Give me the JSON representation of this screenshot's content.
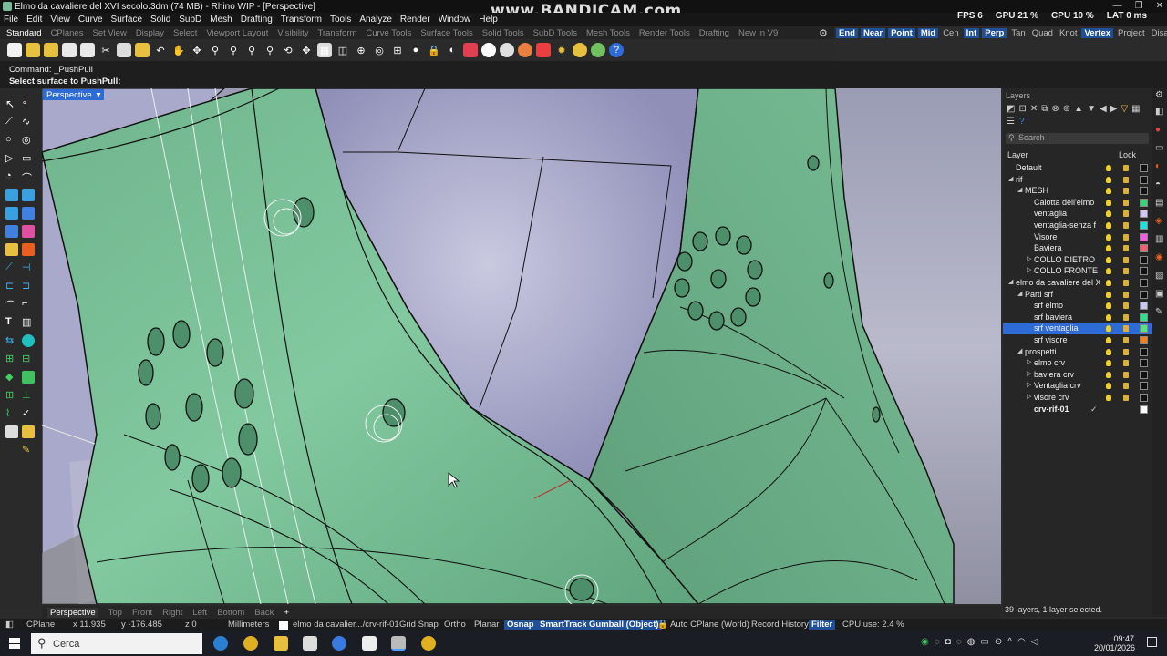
{
  "window": {
    "title": "Elmo da cavaliere del XVI secolo.3dm (74 MB) - Rhino WIP - [Perspective]",
    "watermark": "www.BANDICAM.com",
    "perf": {
      "fps": "FPS   6",
      "gpu": "GPU 21 %",
      "cpu": "CPU 10 %",
      "lat": "LAT 0 ms"
    }
  },
  "menu": [
    "File",
    "Edit",
    "View",
    "Curve",
    "Surface",
    "Solid",
    "SubD",
    "Mesh",
    "Drafting",
    "Transform",
    "Tools",
    "Analyze",
    "Render",
    "Window",
    "Help"
  ],
  "tabs": [
    "Standard",
    "CPlanes",
    "Set View",
    "Display",
    "Select",
    "Viewport Layout",
    "Visibility",
    "Transform",
    "Curve Tools",
    "Surface Tools",
    "Solid Tools",
    "SubD Tools",
    "Mesh Tools",
    "Render Tools",
    "Drafting",
    "New in V9"
  ],
  "osnap": {
    "items": [
      "End",
      "Near",
      "Point",
      "Mid",
      "Cen",
      "Int",
      "Perp",
      "Tan",
      "Quad",
      "Knot",
      "Vertex",
      "Project",
      "Disable"
    ],
    "active": [
      "End",
      "Near",
      "Point",
      "Mid",
      "Int",
      "Perp",
      "Vertex"
    ]
  },
  "command": {
    "line1": "Command: _PushPull",
    "line2": "Select surface to PushPull:"
  },
  "viewport": {
    "label": "Perspective",
    "dropdown": "▾"
  },
  "viewport_tabs": [
    "Perspective",
    "Top",
    "Front",
    "Right",
    "Left",
    "Bottom",
    "Back",
    "+"
  ],
  "layers": {
    "title": "Layers",
    "search_placeholder": "Search",
    "col_layer": "Layer",
    "col_lock": "Lock",
    "rows": [
      {
        "name": "Default",
        "indent": 0,
        "color": "#111111"
      },
      {
        "name": "rif",
        "indent": 0,
        "arrow": "◢",
        "color": "#111111"
      },
      {
        "name": "MESH",
        "indent": 1,
        "arrow": "◢",
        "color": "#111111"
      },
      {
        "name": "Calotta dell'elmo",
        "indent": 2,
        "color": "#3fd07a"
      },
      {
        "name": "ventaglia",
        "indent": 2,
        "color": "#d0c8f0"
      },
      {
        "name": "ventaglia-senza f",
        "indent": 2,
        "color": "#20e0e0"
      },
      {
        "name": "Visore",
        "indent": 2,
        "color": "#f060e0"
      },
      {
        "name": "Baviera",
        "indent": 2,
        "color": "#f06070"
      },
      {
        "name": "COLLO DIETRO",
        "indent": 2,
        "arrow": "▷",
        "color": "#111111"
      },
      {
        "name": "COLLO FRONTE",
        "indent": 2,
        "arrow": "▷",
        "color": "#111111"
      },
      {
        "name": "elmo da cavaliere del X",
        "indent": 0,
        "arrow": "◢",
        "color": "#111111"
      },
      {
        "name": "Parti srf",
        "indent": 1,
        "arrow": "◢",
        "color": "#111111"
      },
      {
        "name": "srf elmo",
        "indent": 2,
        "color": "#c8c8f0"
      },
      {
        "name": "srf baviera",
        "indent": 2,
        "color": "#30e090"
      },
      {
        "name": "srf ventaglia",
        "indent": 2,
        "color": "#60e080",
        "selected": true
      },
      {
        "name": "srf visore",
        "indent": 2,
        "color": "#f08020"
      },
      {
        "name": "prospetti",
        "indent": 1,
        "arrow": "◢",
        "color": "#111111"
      },
      {
        "name": "elmo crv",
        "indent": 2,
        "arrow": "▷",
        "color": "#111111"
      },
      {
        "name": "baviera crv",
        "indent": 2,
        "arrow": "▷",
        "color": "#111111"
      },
      {
        "name": "Ventaglia crv",
        "indent": 2,
        "arrow": "▷",
        "color": "#111111"
      },
      {
        "name": "visore crv",
        "indent": 2,
        "arrow": "▷",
        "color": "#111111"
      },
      {
        "name": "crv-rif-01",
        "indent": 2,
        "color": "#ffffff",
        "current": true
      }
    ],
    "footer": "39 layers, 1 layer selected."
  },
  "status": {
    "cplane": "CPlane",
    "x": "x 11.935",
    "y": "y -176.485",
    "z": "z 0",
    "units": "Millimeters",
    "layer": "elmo da cavalier.../crv-rif-01",
    "grid_snap": "Grid Snap",
    "ortho": "Ortho",
    "planar": "Planar",
    "osnap": "Osnap",
    "smarttrack": "SmartTrack",
    "gumball": "Gumball (Object)",
    "autocplane": "Auto CPlane (World)",
    "history": "Record History",
    "filter": "Filter",
    "cpu": "CPU use: 2.4 %"
  },
  "taskbar": {
    "search": "Cerca",
    "time": "09:47",
    "date": "20/01/2026"
  }
}
